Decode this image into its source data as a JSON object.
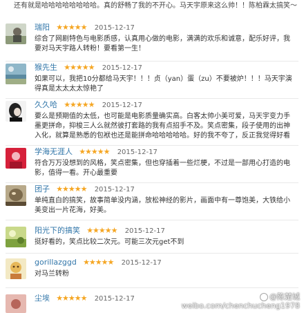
{
  "top_snippet": "还有就是哈哈哈哈哈哈哈哈。真的舒畅了我的不开心。马天宇原来这么帅！！陈柏霖太搞笑～。",
  "reviews": [
    {
      "username": "瑞阳",
      "stars": "★★★★★",
      "date": "2015-12-17",
      "text": "综合了网剧特色与电影质感，认真用心做的电影，满满的欢乐和诚意，配乐好评，我要对马天宇路人转粉！要看第一生！"
    },
    {
      "username": "猴先生",
      "stars": "★★★★★",
      "date": "2015-12-17",
      "text": "如果可以，我把10分都给马天宇！！！贞（yan）蛋（zu）不要被炉！！！马天宇演得真是太太太太惊艳了"
    },
    {
      "username": "久久哈",
      "stars": "★★★★★",
      "date": "2015-12-17",
      "text": "要么是预期值的太低，也可能是电影质量确实高。白客太帅小美可爱，马天宇变力手墨更拼命，抑梭三人么就然彼打套路的我有点招手不及。笑点密集，段子使用的出神入化，就算是熟悉的包袱也还是能拼命哈哈哈哈哈。好的我不夸了，反正我觉得好看"
    },
    {
      "username": "学海无涯人",
      "stars": "★★★★★",
      "date": "2015-12-17",
      "text": "符合万万没想到的风格，笑点密集，但也穿插着一些烂梗，不过是一部用心打造的电影，值得一看。开心最重要"
    },
    {
      "username": "团子",
      "stars": "★★★★★",
      "date": "2015-12-17",
      "text": "单纯直白的搞笑，故事简单没内涵，放松神经的影片，画面中有一尊饱美，大铁给小美变出一片花海，好美。"
    },
    {
      "username": "阳光下的搞笑",
      "stars": "★★★★★",
      "date": "2015-12-17",
      "text": "挺好看的，笑点比较二次元。可能三次元get不到"
    },
    {
      "username": "gorillazggd",
      "stars": "★★★★★",
      "date": "2015-12-17",
      "text": "对马兰转粉"
    },
    {
      "username": "尘埃",
      "stars": "★★★★★",
      "date": "2015-12-17",
      "text": ""
    }
  ],
  "watermark": {
    "handle": "@陈楚城",
    "url": "weibo.com/chenchucheng1978"
  }
}
